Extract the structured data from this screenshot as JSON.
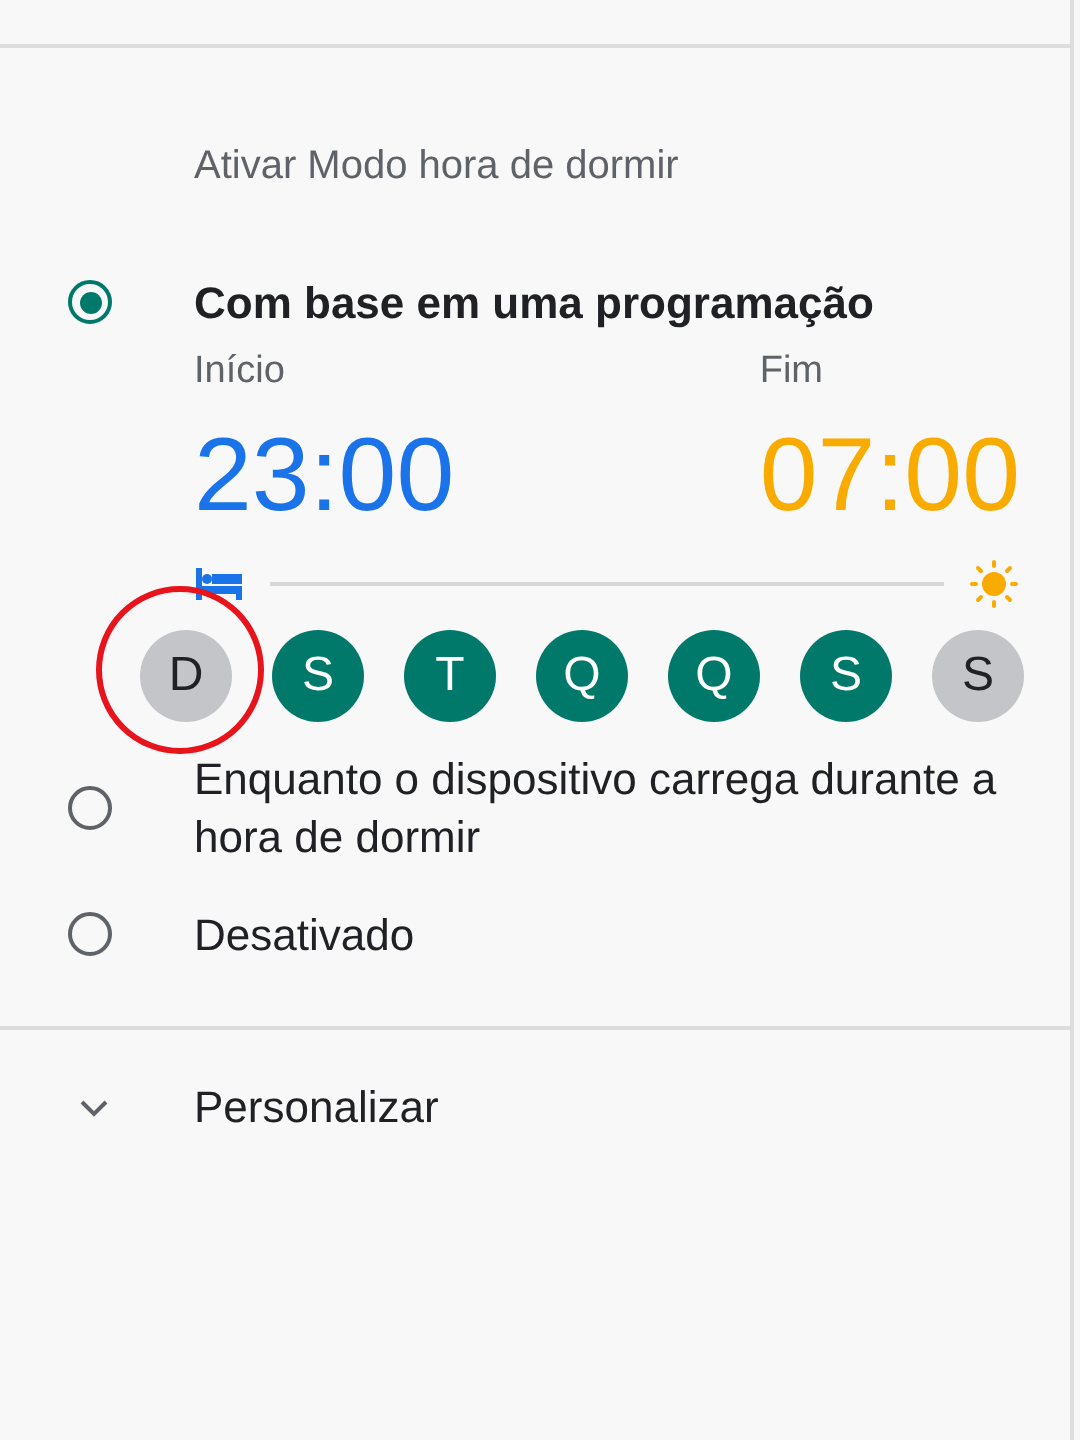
{
  "section_title": "Ativar Modo hora de dormir",
  "options": [
    {
      "kind": "schedule",
      "label": "Com base em uma programação",
      "selected": true,
      "schedule": {
        "start_label": "Início",
        "start_time": "23:00",
        "end_label": "Fim",
        "end_time": "07:00",
        "days": [
          {
            "label": "D",
            "selected": false,
            "circled": true
          },
          {
            "label": "S",
            "selected": true,
            "circled": false
          },
          {
            "label": "T",
            "selected": true,
            "circled": false
          },
          {
            "label": "Q",
            "selected": true,
            "circled": false
          },
          {
            "label": "Q",
            "selected": true,
            "circled": false
          },
          {
            "label": "S",
            "selected": true,
            "circled": false
          },
          {
            "label": "S",
            "selected": false,
            "circled": false
          }
        ]
      }
    },
    {
      "kind": "plain",
      "label": "Enquanto o dispositivo carrega durante a hora de dormir",
      "selected": false
    },
    {
      "kind": "plain",
      "label": "Desativado",
      "selected": false
    }
  ],
  "expander": {
    "label": "Personalizar",
    "expanded": false
  }
}
